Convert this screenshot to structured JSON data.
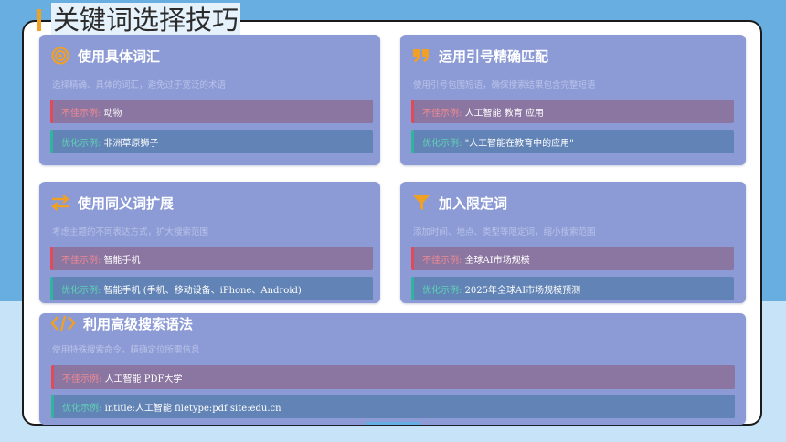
{
  "slide": {
    "title": "关键词选择技巧"
  },
  "colors": {
    "accent": "#f0a023",
    "card_bg": "#8c9bd6",
    "bad_border": "#e04a59",
    "good_border": "#2fb59e"
  },
  "cards": [
    {
      "icon": "target-icon",
      "title": "使用具体词汇",
      "desc": "选择精确、具体的词汇，避免过于宽泛的术语",
      "bad_label": "不佳示例:",
      "bad_value": "动物",
      "good_label": "优化示例:",
      "good_value": "非洲草原狮子"
    },
    {
      "icon": "quote-icon",
      "title": "运用引号精确匹配",
      "desc": "使用引号包围短语，确保搜索结果包含完整短语",
      "bad_label": "不佳示例:",
      "bad_value": "人工智能 教育 应用",
      "good_label": "优化示例:",
      "good_value": "\"人工智能在教育中的应用\""
    },
    {
      "icon": "swap-arrows-icon",
      "title": "使用同义词扩展",
      "desc": "考虑主题的不同表达方式，扩大搜索范围",
      "bad_label": "不佳示例:",
      "bad_value": "智能手机",
      "good_label": "优化示例:",
      "good_value": "智能手机 (手机、移动设备、iPhone、Android)"
    },
    {
      "icon": "filter-icon",
      "title": "加入限定词",
      "desc": "添加时间、地点、类型等限定词，缩小搜索范围",
      "bad_label": "不佳示例:",
      "bad_value": "全球AI市场规模",
      "good_label": "优化示例:",
      "good_value": "2025年全球AI市场规模预测"
    },
    {
      "icon": "code-icon",
      "title": "利用高级搜索语法",
      "desc": "使用特殊搜索命令，精确定位所需信息",
      "bad_label": "不佳示例:",
      "bad_value": "人工智能 PDF大学",
      "good_label": "优化示例:",
      "good_value": "intitle:人工智能 filetype:pdf site:edu.cn"
    }
  ]
}
